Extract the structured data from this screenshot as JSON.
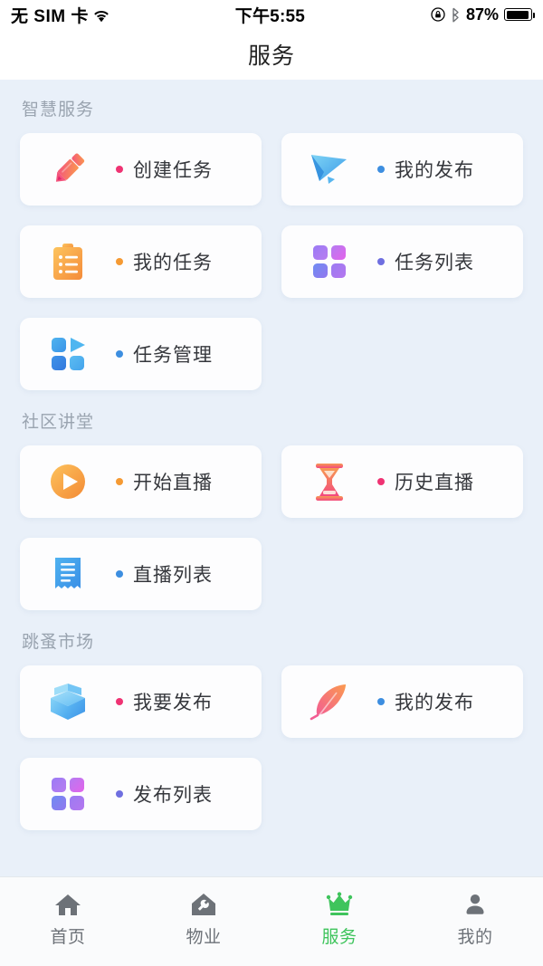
{
  "status_bar": {
    "carrier": "无 SIM 卡",
    "wifi_icon": "wifi-icon",
    "time": "下午5:55",
    "rotation_lock_icon": "rotation-lock-icon",
    "bluetooth_icon": "bluetooth-icon",
    "battery_percent": "87%",
    "battery_icon": "battery-icon"
  },
  "header": {
    "title": "服务"
  },
  "sections": [
    {
      "label": "智慧服务",
      "items": [
        {
          "label": "创建任务",
          "icon": "pencil-icon",
          "dot_color": "#ef3373"
        },
        {
          "label": "我的发布",
          "icon": "paper-plane-icon",
          "dot_color": "#3d8ee0"
        },
        {
          "label": "我的任务",
          "icon": "clipboard-icon",
          "dot_color": "#f59a33"
        },
        {
          "label": "任务列表",
          "icon": "grid-four-icon",
          "dot_color": "#6f6fe0"
        },
        {
          "label": "任务管理",
          "icon": "grid-play-icon",
          "dot_color": "#3d8ee0"
        }
      ]
    },
    {
      "label": "社区讲堂",
      "items": [
        {
          "label": "开始直播",
          "icon": "play-circle-icon",
          "dot_color": "#f59a33"
        },
        {
          "label": "历史直播",
          "icon": "hourglass-icon",
          "dot_color": "#ef3373"
        },
        {
          "label": "直播列表",
          "icon": "receipt-icon",
          "dot_color": "#3d8ee0"
        }
      ]
    },
    {
      "label": "跳蚤市场",
      "items": [
        {
          "label": "我要发布",
          "icon": "open-box-icon",
          "dot_color": "#ef3373"
        },
        {
          "label": "我的发布",
          "icon": "feather-quill-icon",
          "dot_color": "#3d8ee0"
        },
        {
          "label": "发布列表",
          "icon": "grid-four-icon",
          "dot_color": "#6f6fe0"
        }
      ]
    }
  ],
  "tabbar": {
    "active_color": "#3ec45c",
    "inactive_color": "#6d7278",
    "tabs": [
      {
        "label": "首页",
        "icon": "home-icon",
        "active": false
      },
      {
        "label": "物业",
        "icon": "house-wrench-icon",
        "active": false
      },
      {
        "label": "服务",
        "icon": "crown-icon",
        "active": true
      },
      {
        "label": "我的",
        "icon": "person-icon",
        "active": false
      }
    ]
  }
}
